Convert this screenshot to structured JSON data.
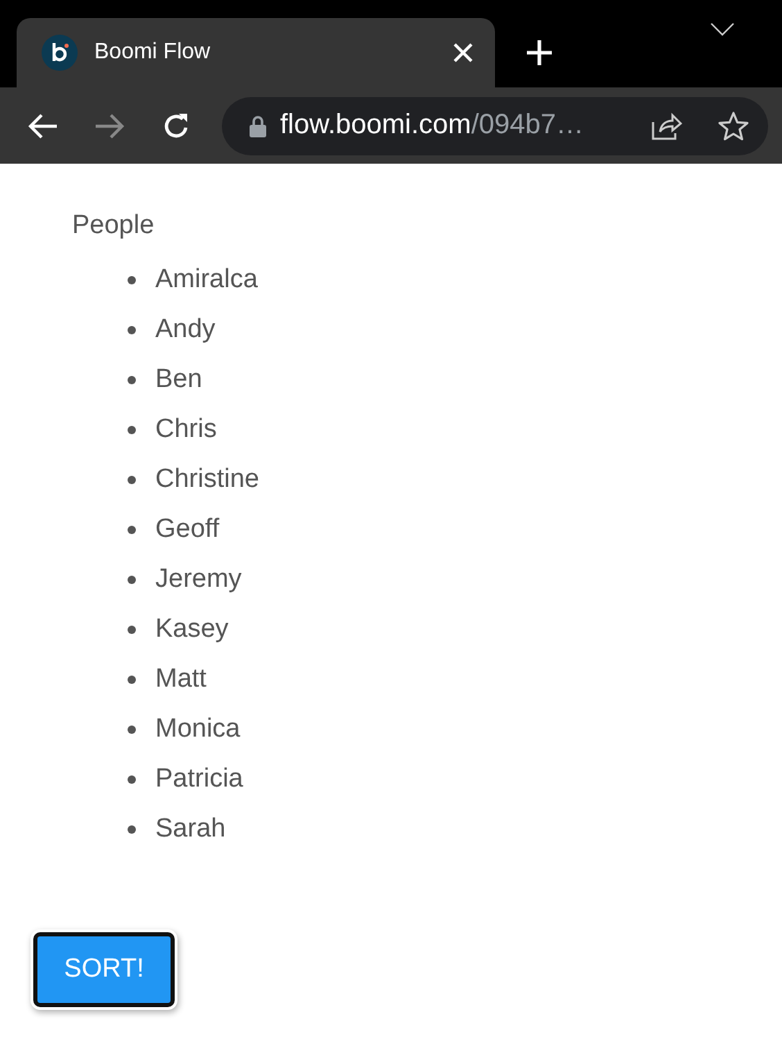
{
  "browser": {
    "tab": {
      "title": "Boomi Flow",
      "selected": true
    },
    "url_host": "flow.boomi.com",
    "url_path": "/094b7…"
  },
  "list": {
    "title": "People",
    "items": [
      "Amiralca",
      "Andy",
      "Ben",
      "Chris",
      "Christine",
      "Geoff",
      "Jeremy",
      "Kasey",
      "Matt",
      "Monica",
      "Patricia",
      "Sarah"
    ]
  },
  "button": {
    "label": "SORT!"
  }
}
